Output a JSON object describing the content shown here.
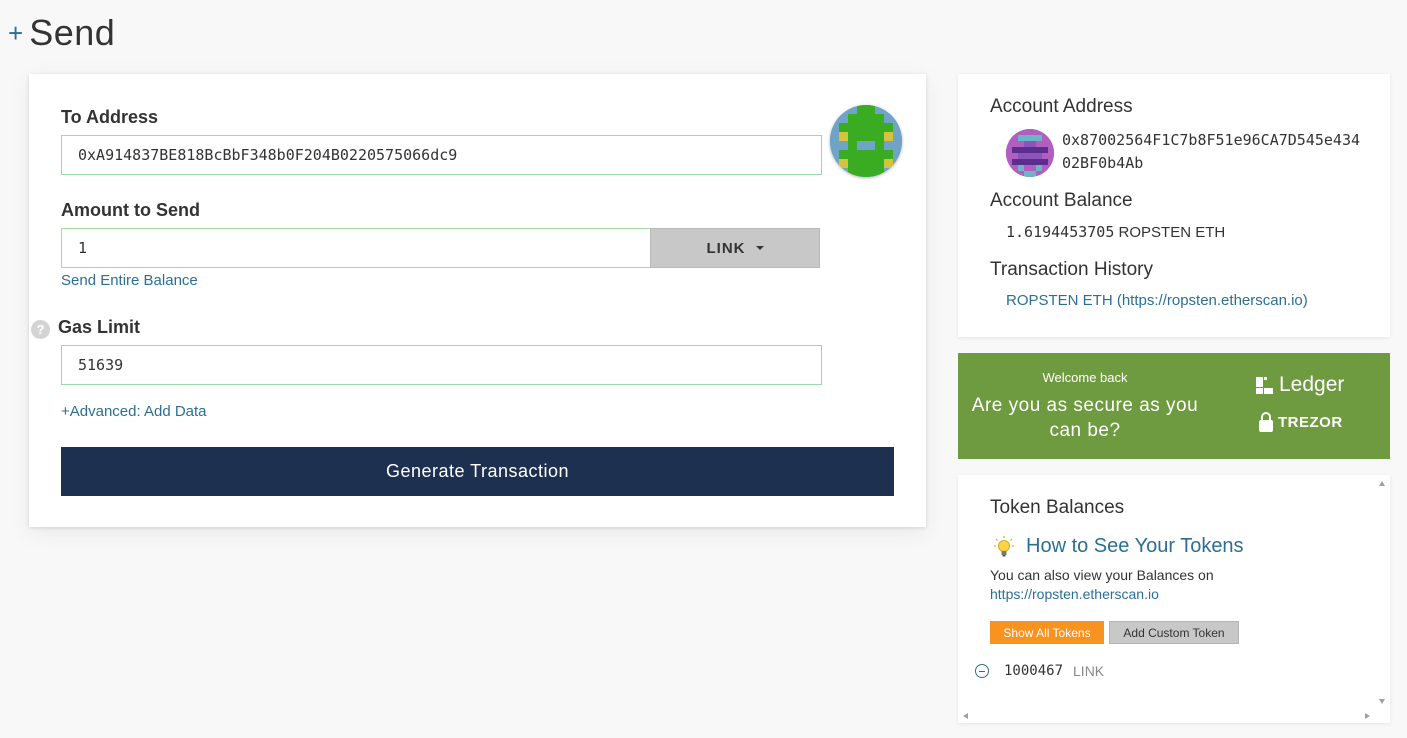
{
  "header": {
    "plus": "+",
    "title": "Send"
  },
  "send_form": {
    "to_address_label": "To Address",
    "to_address_value": "0xA914837BE818BcBbF348b0F204B0220575066dc9",
    "amount_label": "Amount to Send",
    "amount_value": "1",
    "unit_selected": "LINK",
    "send_entire_balance": "Send Entire Balance",
    "gas_limit_label": "Gas Limit",
    "gas_limit_value": "51639",
    "help_glyph": "?",
    "advanced_link": "+Advanced: Add Data",
    "generate_button": "Generate Transaction",
    "identicon_colors": {
      "background": "#6fa4c8",
      "green": "#3aac22",
      "yellow": "#d4c43c"
    }
  },
  "account": {
    "address_heading": "Account Address",
    "address": "0x87002564F1C7b8F51e96CA7D545e43402BF0b4Ab",
    "balance_heading": "Account Balance",
    "balance_amount": "1.6194453705",
    "balance_unit": "ROPSTEN ETH",
    "history_heading": "Transaction History",
    "history_link": "ROPSTEN ETH (https://ropsten.etherscan.io)",
    "identicon_colors": {
      "background": "#b15ec1",
      "purple": "#5b2d8c",
      "teal": "#6bb6c4"
    }
  },
  "promo": {
    "small_text": "Welcome back",
    "big_text": "Are you as secure as you can be?",
    "ledger": "Ledger",
    "trezor": "TREZOR",
    "background": "#6e9b3f"
  },
  "tokens": {
    "heading": "Token Balances",
    "howto_link": "How to See Your Tokens",
    "info_text": "You can also view your Balances on",
    "info_link": "https://ropsten.etherscan.io",
    "show_all_button": "Show All Tokens",
    "add_custom_button": "Add Custom Token",
    "items": [
      {
        "amount": "1000467",
        "symbol": "LINK"
      }
    ]
  },
  "colors": {
    "link": "#2c6f94",
    "primary_button": "#1e3050",
    "orange": "#f7931e"
  }
}
